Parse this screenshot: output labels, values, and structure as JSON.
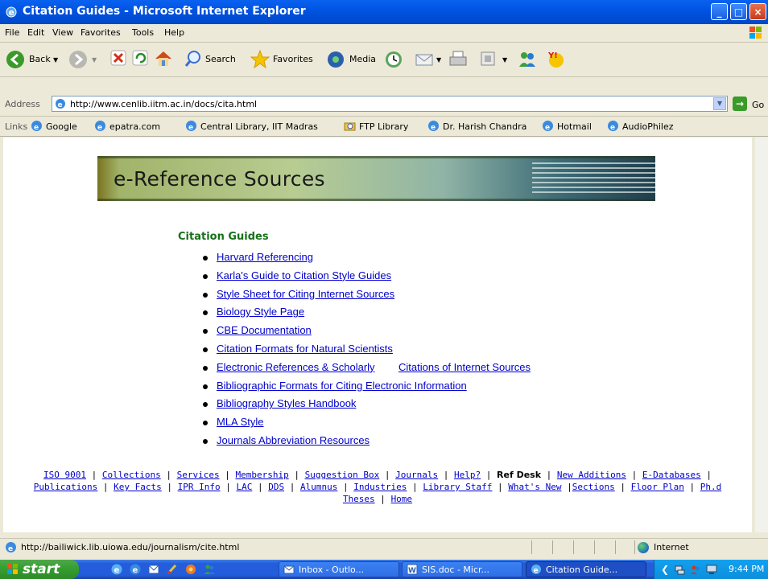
{
  "window": {
    "title": "Citation Guides - Microsoft Internet Explorer",
    "controls": {
      "minimize": "_",
      "maximize": "□",
      "close": "×"
    }
  },
  "menu": [
    "File",
    "Edit",
    "View",
    "Favorites",
    "Tools",
    "Help"
  ],
  "toolbar": {
    "back": "Back",
    "search": "Search",
    "favorites": "Favorites",
    "media": "Media"
  },
  "address": {
    "label": "Address",
    "url": "http://www.cenlib.iitm.ac.in/docs/cita.html",
    "go": "Go"
  },
  "links": {
    "label": "Links",
    "items": [
      "Google",
      "epatra.com",
      "Central Library, IIT Madras",
      "FTP Library",
      "Dr. Harish Chandra",
      "Hotmail",
      "AudioPhilez"
    ]
  },
  "page": {
    "banner": "e-Reference Sources",
    "heading": "Citation Guides",
    "guides": [
      "Harvard Referencing",
      "Karla's Guide to Citation Style Guides",
      "Style Sheet for Citing Internet Sources",
      "Biology Style Page",
      "CBE Documentation",
      "Citation Formats for Natural Scientists",
      "Electronic References & Scholarly",
      "Bibliographic Formats for Citing Electronic Information",
      "Bibliography Styles Handbook",
      "MLA Style",
      "Journals Abbreviation Resources"
    ],
    "guide_second_link": "Citations of Internet Sources",
    "footer": {
      "line1": [
        "ISO 9001",
        "Collections",
        "Services",
        "Membership",
        "Suggestion Box",
        "Journals",
        "Help?",
        "Ref Desk",
        "New Additions",
        "E-Databases"
      ],
      "line2": [
        "Publications",
        "Key Facts",
        "IPR Info",
        "LAC",
        "DDS",
        "Alumnus",
        "Industries",
        "Library Staff",
        "What's New",
        "Sections",
        "Floor Plan",
        "Ph.d"
      ],
      "line3": [
        "Theses",
        "Home"
      ]
    }
  },
  "status": {
    "text": "http://bailiwick.lib.uiowa.edu/journalism/cite.html",
    "zone": "Internet"
  },
  "taskbar": {
    "start": "start",
    "tasks": [
      "Inbox - Outlo...",
      "SIS.doc - Micr...",
      "Citation Guide..."
    ],
    "clock": "9:44 PM"
  }
}
